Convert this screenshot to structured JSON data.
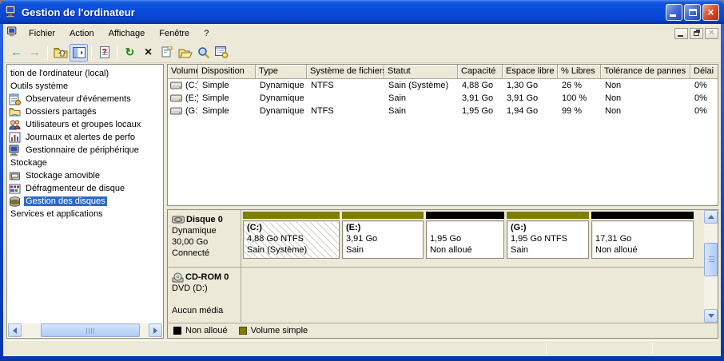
{
  "window": {
    "title": "Gestion de l'ordinateur",
    "controls": [
      "minimize",
      "maximize",
      "close"
    ]
  },
  "menubar": {
    "items": [
      "Fichier",
      "Action",
      "Affichage",
      "Fenêtre",
      "?"
    ],
    "mdi_controls": [
      "minimize",
      "restore",
      "close"
    ]
  },
  "toolbar": {
    "buttons": [
      "back",
      "forward",
      "up-folder",
      "toggle-console-tree",
      "help",
      "refresh",
      "delete",
      "properties",
      "open-folder",
      "search",
      "console-settings"
    ],
    "glyphs": {
      "back": "←",
      "forward": "→",
      "refresh": "↻",
      "delete": "×",
      "help": "?"
    }
  },
  "sidebar": {
    "items": [
      {
        "label": "tion de l'ordinateur (local)",
        "icon": ""
      },
      {
        "label": "Outils système",
        "icon": ""
      },
      {
        "label": "Observateur d'événements",
        "icon": "event-viewer"
      },
      {
        "label": "Dossiers partagés",
        "icon": "shared-folders"
      },
      {
        "label": "Utilisateurs et groupes locaux",
        "icon": "local-users"
      },
      {
        "label": "Journaux et alertes de perfo",
        "icon": "perf-logs"
      },
      {
        "label": "Gestionnaire de périphérique",
        "icon": "device-manager"
      },
      {
        "label": "Stockage",
        "icon": ""
      },
      {
        "label": "Stockage amovible",
        "icon": "removable-storage"
      },
      {
        "label": "Défragmenteur de disque",
        "icon": "defrag"
      },
      {
        "label": "Gestion des disques",
        "icon": "disk-management",
        "selected": true
      },
      {
        "label": "Services et applications",
        "icon": ""
      }
    ]
  },
  "volumes": {
    "columns": [
      "Volume",
      "Disposition",
      "Type",
      "Système de fichiers",
      "Statut",
      "Capacité",
      "Espace libre",
      "% Libres",
      "Tolérance de pannes",
      "Délai"
    ],
    "rows": [
      {
        "volume": "(C:)",
        "disposition": "Simple",
        "type": "Dynamique",
        "fs": "NTFS",
        "statut": "Sain (Système)",
        "capacite": "4,88 Go",
        "libre": "1,30 Go",
        "pct": "26 %",
        "tolerance": "Non",
        "delai": "0%"
      },
      {
        "volume": "(E:)",
        "disposition": "Simple",
        "type": "Dynamique",
        "fs": "",
        "statut": "Sain",
        "capacite": "3,91 Go",
        "libre": "3,91 Go",
        "pct": "100 %",
        "tolerance": "Non",
        "delai": "0%"
      },
      {
        "volume": "(G:)",
        "disposition": "Simple",
        "type": "Dynamique",
        "fs": "NTFS",
        "statut": "Sain",
        "capacite": "1,95 Go",
        "libre": "1,94 Go",
        "pct": "99 %",
        "tolerance": "Non",
        "delai": "0%"
      }
    ]
  },
  "disks": {
    "disk0": {
      "name": "Disque 0",
      "type": "Dynamique",
      "size": "30,00 Go",
      "status": "Connecté",
      "partitions": [
        {
          "letter": "(C:)",
          "size": "4,88 Go NTFS",
          "status": "Sain (Système)",
          "kind": "simple",
          "hatched": true
        },
        {
          "letter": "(E:)",
          "size": "3,91 Go",
          "status": "Sain",
          "kind": "simple"
        },
        {
          "letter": "",
          "size": "1,95 Go",
          "status": "Non alloué",
          "kind": "unallocated"
        },
        {
          "letter": "(G:)",
          "size": "1,95 Go NTFS",
          "status": "Sain",
          "kind": "simple"
        },
        {
          "letter": "",
          "size": "17,31 Go",
          "status": "Non alloué",
          "kind": "unallocated"
        }
      ]
    },
    "cdrom0": {
      "name": "CD-ROM 0",
      "type": "DVD (D:)",
      "status": "Aucun média"
    }
  },
  "legend": {
    "items": [
      {
        "label": "Non alloué",
        "color": "#000000"
      },
      {
        "label": "Volume simple",
        "color": "#7E7E00"
      }
    ]
  },
  "colors": {
    "titlebar_blue": "#0A4ADB",
    "chrome_beige": "#ECE9D8",
    "selection_blue": "#316AC5",
    "simple_volume_olive": "#7E7E00",
    "unallocated_black": "#000000"
  }
}
